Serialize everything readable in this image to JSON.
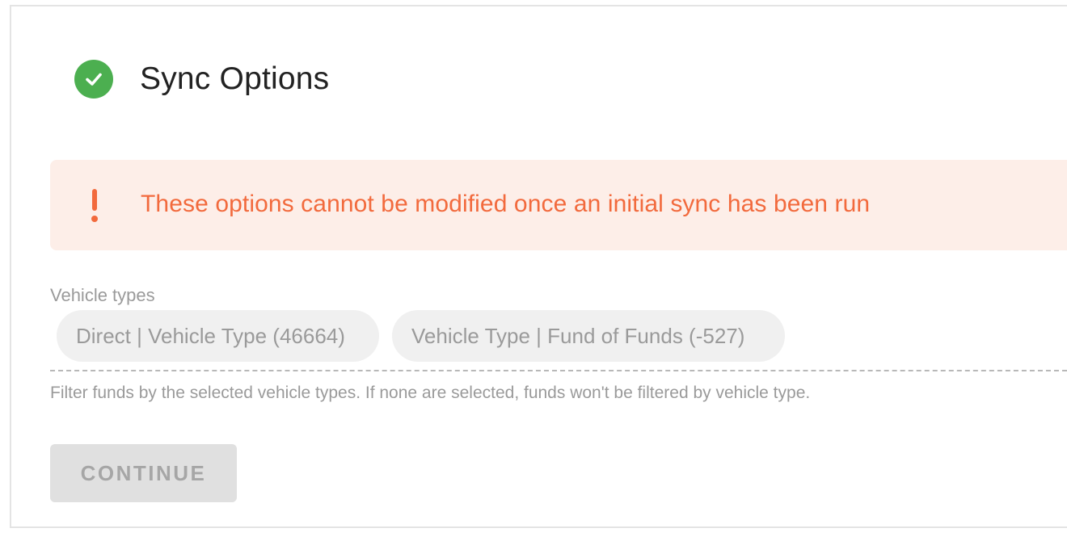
{
  "step": {
    "title": "Sync Options",
    "status_icon": "check-circle-icon",
    "status_color": "#4caf50"
  },
  "alert": {
    "icon": "exclamation-icon",
    "message": "These options cannot be modified once an initial sync has been run",
    "text_color": "#f26a3d",
    "background_color": "#fdeee8"
  },
  "vehicle_types": {
    "label": "Vehicle types",
    "selected": [
      "Direct | Vehicle Type (46664)",
      "Vehicle Type | Fund of Funds (-527)"
    ],
    "helper_text": "Filter funds by the selected vehicle types. If none are selected, funds won't be filtered by vehicle type."
  },
  "actions": {
    "continue_label": "CONTINUE",
    "continue_disabled": true
  }
}
